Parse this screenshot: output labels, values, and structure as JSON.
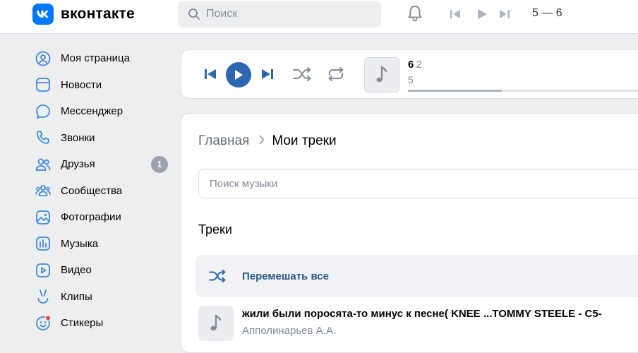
{
  "app": {
    "logo_text": "вконтакте"
  },
  "header": {
    "search_placeholder": "Поиск",
    "now_playing_short": "5 — 6"
  },
  "sidebar": {
    "items": [
      {
        "label": "Моя страница",
        "icon": "profile-icon"
      },
      {
        "label": "Новости",
        "icon": "news-icon"
      },
      {
        "label": "Мессенджер",
        "icon": "messenger-icon"
      },
      {
        "label": "Звонки",
        "icon": "phone-icon"
      },
      {
        "label": "Друзья",
        "icon": "friends-icon",
        "badge": "1"
      },
      {
        "label": "Сообщества",
        "icon": "communities-icon"
      },
      {
        "label": "Фотографии",
        "icon": "photos-icon"
      },
      {
        "label": "Музыка",
        "icon": "music-icon"
      },
      {
        "label": "Видео",
        "icon": "video-icon"
      },
      {
        "label": "Клипы",
        "icon": "clips-icon"
      },
      {
        "label": "Стикеры",
        "icon": "stickers-icon"
      }
    ]
  },
  "player": {
    "title": "6",
    "title_extra": "2",
    "artist": "5",
    "progress": 0.39
  },
  "breadcrumb": {
    "home": "Главная",
    "current": "Мои треки"
  },
  "music_search": {
    "placeholder": "Поиск музыки"
  },
  "tracks_section": {
    "title": "Треки",
    "shuffle_label": "Перемешать все",
    "items": [
      {
        "title": "жили были поросята-то минус к песне( KNEE ...TOMMY STEELE - C5-",
        "artist": "Апполинарьев А.А."
      }
    ]
  },
  "colors": {
    "accent": "#2d67b2",
    "brand": "#0077ff",
    "link": "#2a5885",
    "icon": "#3f8ae0",
    "muted": "#818c99"
  }
}
